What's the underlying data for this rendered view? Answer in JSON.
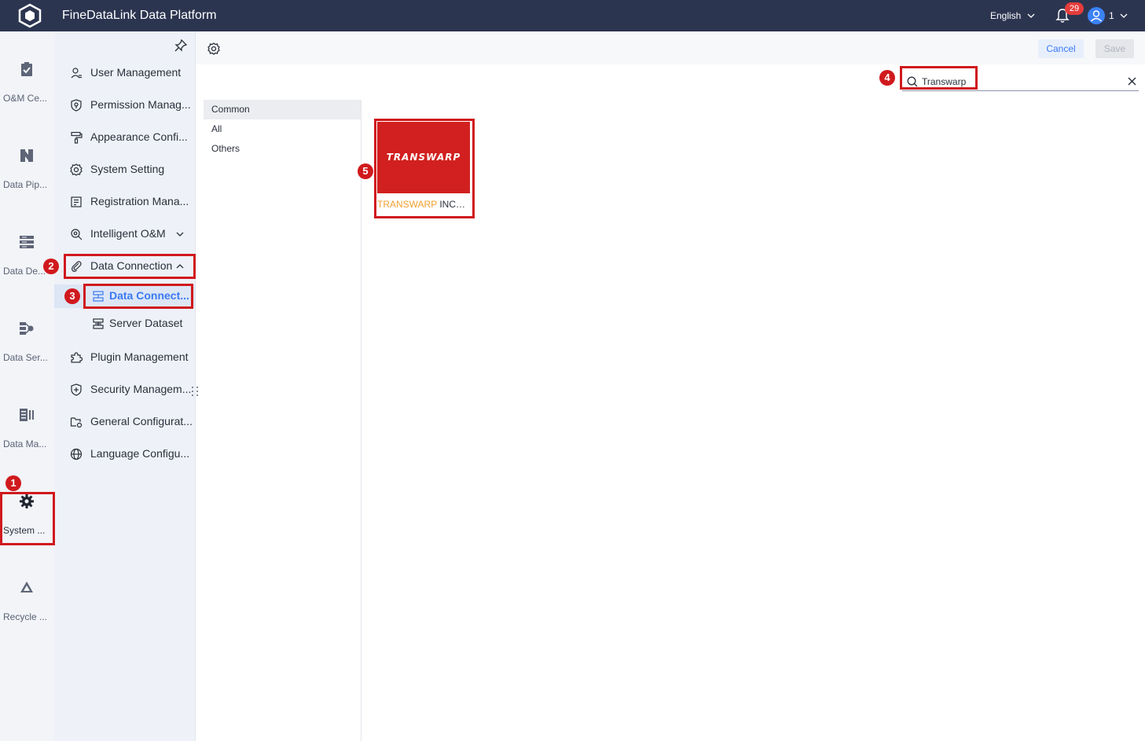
{
  "app": {
    "title": "FineDataLink Data Platform"
  },
  "header": {
    "language": "English",
    "notification_count": "29",
    "user_number": "1"
  },
  "rail": [
    {
      "label": "O&M Ce...",
      "icon": "clipboard-check-icon"
    },
    {
      "label": "Data Pip...",
      "icon": "pipeline-icon"
    },
    {
      "label": "Data De...",
      "icon": "server-stack-icon"
    },
    {
      "label": "Data Ser...",
      "icon": "data-service-icon"
    },
    {
      "label": "Data Ma...",
      "icon": "data-map-icon"
    },
    {
      "label": "System ...",
      "icon": "gear-icon",
      "active": true
    },
    {
      "label": "Recycle ...",
      "icon": "recycle-icon"
    }
  ],
  "menu": {
    "items": [
      {
        "label": "User Management",
        "icon": "user-icon"
      },
      {
        "label": "Permission Manag...",
        "icon": "shield-key-icon"
      },
      {
        "label": "Appearance Confi...",
        "icon": "paint-roller-icon"
      },
      {
        "label": "System Setting",
        "icon": "gear-icon"
      },
      {
        "label": "Registration Mana...",
        "icon": "registration-icon"
      },
      {
        "label": "Intelligent O&M",
        "icon": "search-gear-icon"
      },
      {
        "label": "Data Connection",
        "icon": "paperclip-icon"
      },
      {
        "label": "Plugin Management",
        "icon": "puzzle-icon"
      },
      {
        "label": "Security Managem...",
        "icon": "shield-plus-icon"
      },
      {
        "label": "General Configurat...",
        "icon": "folder-gear-icon"
      },
      {
        "label": "Language Configu...",
        "icon": "globe-icon"
      }
    ],
    "sub_items": [
      {
        "label": "Data Connect...",
        "icon": "database-connection-icon",
        "active": true
      },
      {
        "label": "Server Dataset",
        "icon": "server-dataset-icon"
      }
    ]
  },
  "toolbar": {
    "cancel_label": "Cancel",
    "save_label": "Save"
  },
  "search": {
    "value": "Transwarp"
  },
  "categories": [
    {
      "label": "Common",
      "active": true
    },
    {
      "label": "All"
    },
    {
      "label": "Others"
    }
  ],
  "connectors": [
    {
      "logo_text": "TRANSWARP",
      "label_highlight": "TRANSWARP",
      "label_rest": " INCE..."
    }
  ],
  "annotations": [
    "1",
    "2",
    "3",
    "4",
    "5"
  ],
  "colors": {
    "topbar": "#2c3550",
    "accent": "#3a7af2",
    "annotation": "#d0191d",
    "connector_bg": "#d1201f",
    "highlight": "#f0a030"
  }
}
